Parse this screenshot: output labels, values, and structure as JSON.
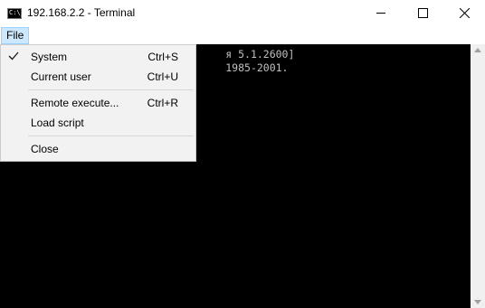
{
  "window": {
    "title": "192.168.2.2 - Terminal",
    "icon_text": "C:\\_",
    "controls": [
      "minimize-icon",
      "maximize-icon",
      "close-icon"
    ]
  },
  "menubar": {
    "file_label": "File"
  },
  "menu": {
    "items": [
      {
        "label": "System",
        "shortcut": "Ctrl+S",
        "checked": true
      },
      {
        "label": "Current user",
        "shortcut": "Ctrl+U",
        "checked": false
      },
      {
        "label": "Remote execute...",
        "shortcut": "Ctrl+R",
        "checked": false
      },
      {
        "label": "Load script",
        "shortcut": "",
        "checked": false
      },
      {
        "label": "Close",
        "shortcut": "",
        "checked": false
      }
    ]
  },
  "terminal": {
    "lines": [
      "                                    я 5.1.2600]",
      "                                    1985-2001."
    ],
    "background": "#000000",
    "text_color": "#c0c0c0"
  },
  "colors": {
    "menu_highlight": "#cce8ff",
    "menu_background": "#f2f2f2"
  }
}
